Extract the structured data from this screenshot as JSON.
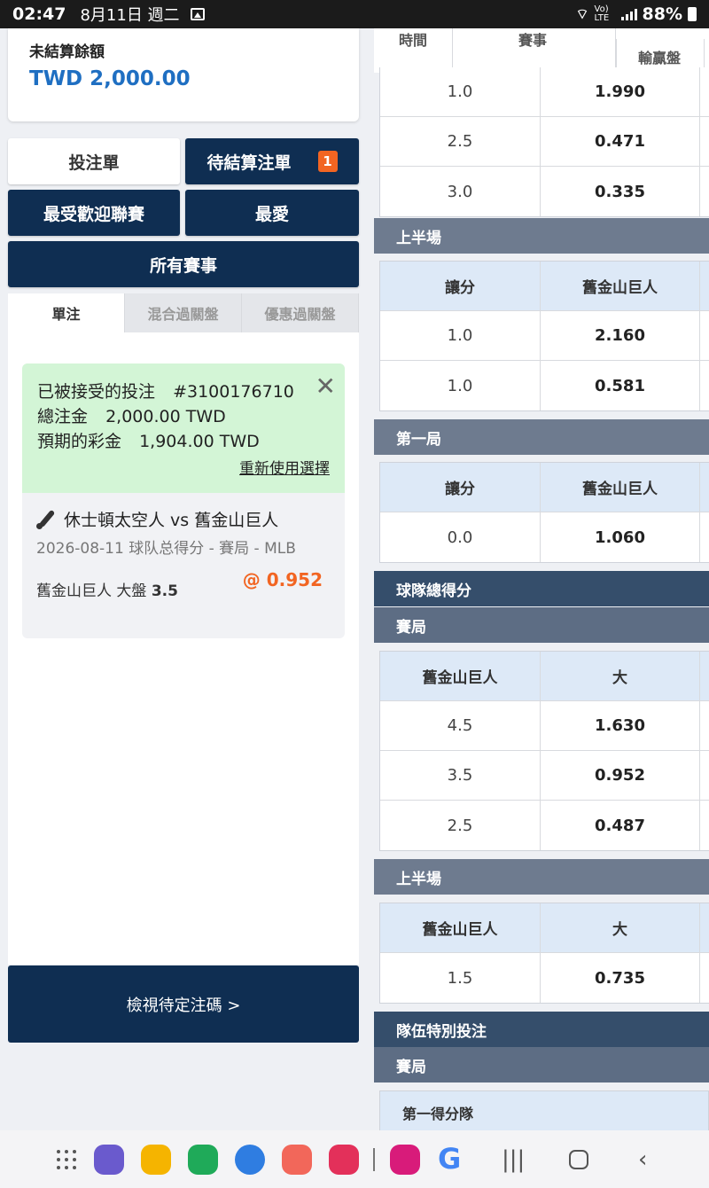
{
  "status_bar": {
    "time": "02:47",
    "date": "8月11日 週二",
    "network": "Vo) LTE",
    "battery": "88%"
  },
  "balance": {
    "label": "未結算餘額",
    "value": "TWD 2,000.00"
  },
  "nav": {
    "betslip": "投注單",
    "pending": "待結算注單",
    "pending_count": "1",
    "popular": "最受歡迎聯賽",
    "favorites": "最愛",
    "all_events": "所有賽事"
  },
  "bet_tabs": [
    "單注",
    "混合過關盤",
    "優惠過關盤"
  ],
  "accepted_bet": {
    "title": "已被接受的投注",
    "ticket": "#3100176710",
    "stake_label": "總注金",
    "stake": "2,000.00 TWD",
    "payout_label": "預期的彩金",
    "payout": "1,904.00 TWD",
    "reuse": "重新使用選擇",
    "match": "休士頓太空人 vs 舊金山巨人",
    "meta": "2026-08-11 球队总得分 - 賽局 - MLB",
    "selection_team": "舊金山巨人 大盤",
    "selection_line": "3.5",
    "odds": "@ 0.952"
  },
  "view_pending": "檢視待定注碼 >",
  "right_panel": {
    "header_cols": [
      "時間",
      "賽事",
      "輸贏盤"
    ],
    "handicap_rows_top": [
      {
        "line": "1.0",
        "odds": "1.990"
      },
      {
        "line": "2.5",
        "odds": "0.471"
      },
      {
        "line": "3.0",
        "odds": "0.335"
      }
    ],
    "first_half_label": "上半場",
    "first_half_table": {
      "head": [
        "讓分",
        "舊金山巨人"
      ],
      "rows": [
        {
          "line": "1.0",
          "odds": "2.160"
        },
        {
          "line": "1.0",
          "odds": "0.581"
        }
      ]
    },
    "first_inning_label": "第一局",
    "first_inning_table": {
      "head": [
        "讓分",
        "舊金山巨人"
      ],
      "rows": [
        {
          "line": "0.0",
          "odds": "1.060"
        }
      ]
    },
    "team_total_label": "球隊總得分",
    "game_label": "賽局",
    "team_total_table": {
      "head": [
        "舊金山巨人",
        "大"
      ],
      "rows": [
        {
          "line": "4.5",
          "odds": "1.630"
        },
        {
          "line": "3.5",
          "odds": "0.952"
        },
        {
          "line": "2.5",
          "odds": "0.487"
        }
      ]
    },
    "team_total_half_label": "上半場",
    "team_total_half_table": {
      "head": [
        "舊金山巨人",
        "大"
      ],
      "rows": [
        {
          "line": "1.5",
          "odds": "0.735"
        }
      ]
    },
    "team_special_label": "隊伍特別投注",
    "team_special_game_label": "賽局",
    "first_score_label": "第一得分隊"
  },
  "colors": {
    "navy": "#0f2e52",
    "accent_orange": "#f26522",
    "balance_blue": "#1f6fc2",
    "accepted_green": "#d3f5d6"
  }
}
